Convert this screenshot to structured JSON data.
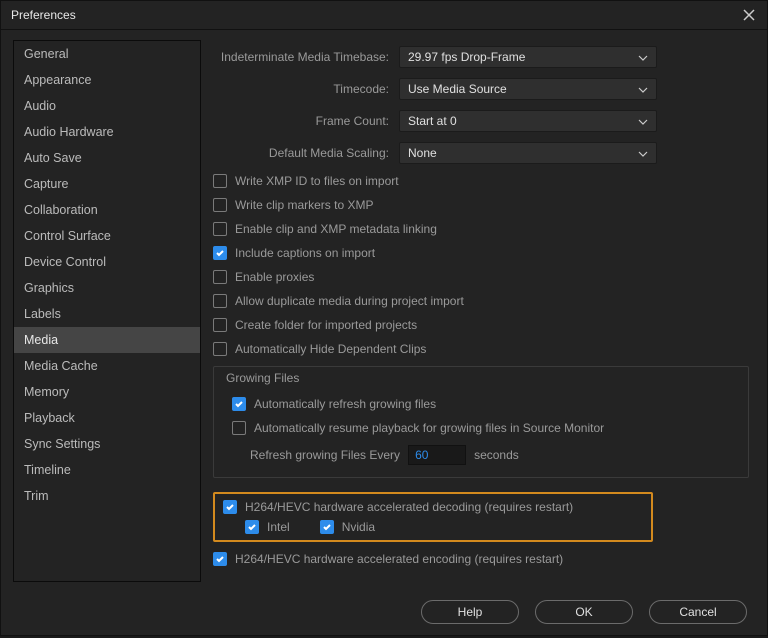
{
  "window": {
    "title": "Preferences"
  },
  "sidebar": {
    "items": [
      {
        "label": "General"
      },
      {
        "label": "Appearance"
      },
      {
        "label": "Audio"
      },
      {
        "label": "Audio Hardware"
      },
      {
        "label": "Auto Save"
      },
      {
        "label": "Capture"
      },
      {
        "label": "Collaboration"
      },
      {
        "label": "Control Surface"
      },
      {
        "label": "Device Control"
      },
      {
        "label": "Graphics"
      },
      {
        "label": "Labels"
      },
      {
        "label": "Media"
      },
      {
        "label": "Media Cache"
      },
      {
        "label": "Memory"
      },
      {
        "label": "Playback"
      },
      {
        "label": "Sync Settings"
      },
      {
        "label": "Timeline"
      },
      {
        "label": "Trim"
      }
    ],
    "selected_index": 11
  },
  "dropdowns": {
    "timebase": {
      "label": "Indeterminate Media Timebase:",
      "value": "29.97 fps Drop-Frame"
    },
    "timecode": {
      "label": "Timecode:",
      "value": "Use Media Source"
    },
    "framecount": {
      "label": "Frame Count:",
      "value": "Start at 0"
    },
    "scaling": {
      "label": "Default Media Scaling:",
      "value": "None"
    }
  },
  "checks": {
    "xmp_id": {
      "label": "Write XMP ID to files on import",
      "checked": false
    },
    "clip_markers": {
      "label": "Write clip markers to XMP",
      "checked": false
    },
    "enable_link": {
      "label": "Enable clip and XMP metadata linking",
      "checked": false
    },
    "captions": {
      "label": "Include captions on import",
      "checked": true
    },
    "proxies": {
      "label": "Enable proxies",
      "checked": false
    },
    "duplicate": {
      "label": "Allow duplicate media during project import",
      "checked": false
    },
    "create_folder": {
      "label": "Create folder for imported projects",
      "checked": false
    },
    "hide_dependent": {
      "label": "Automatically Hide Dependent Clips",
      "checked": false
    }
  },
  "growing": {
    "legend": "Growing Files",
    "auto_refresh": {
      "label": "Automatically refresh growing files",
      "checked": true
    },
    "auto_resume": {
      "label": "Automatically resume playback for growing files in Source Monitor",
      "checked": false
    },
    "refresh_label_pre": "Refresh growing Files Every",
    "refresh_value": "60",
    "refresh_label_post": "seconds"
  },
  "hw_decode": {
    "label": "H264/HEVC hardware accelerated decoding (requires restart)",
    "checked": true,
    "intel": {
      "label": "Intel",
      "checked": true
    },
    "nvidia": {
      "label": "Nvidia",
      "checked": true
    }
  },
  "hw_encode": {
    "label": "H264/HEVC hardware accelerated encoding (requires restart)",
    "checked": true
  },
  "footer": {
    "help": "Help",
    "ok": "OK",
    "cancel": "Cancel"
  }
}
